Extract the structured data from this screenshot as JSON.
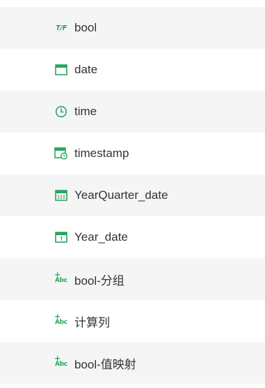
{
  "fields": [
    {
      "label": "bool",
      "icon": "boolean-tf-icon",
      "tf_text": "T/F"
    },
    {
      "label": "date",
      "icon": "calendar-icon"
    },
    {
      "label": "time",
      "icon": "clock-icon"
    },
    {
      "label": "timestamp",
      "icon": "calendar-clock-icon"
    },
    {
      "label": "YearQuarter_date",
      "icon": "calendar-grid-icon"
    },
    {
      "label": "Year_date",
      "icon": "calendar-year-icon"
    },
    {
      "label": "bool-分组",
      "icon": "add-text-field-icon",
      "abc_text": "Abc"
    },
    {
      "label": "计算列",
      "icon": "add-text-field-icon",
      "abc_text": "Abc"
    },
    {
      "label": "bool-值映射",
      "icon": "add-text-field-icon",
      "abc_text": "Abc"
    }
  ],
  "colors": {
    "accent": "#2aa55e",
    "row_alt_bg": "#f5f5f6",
    "text": "#333333"
  }
}
